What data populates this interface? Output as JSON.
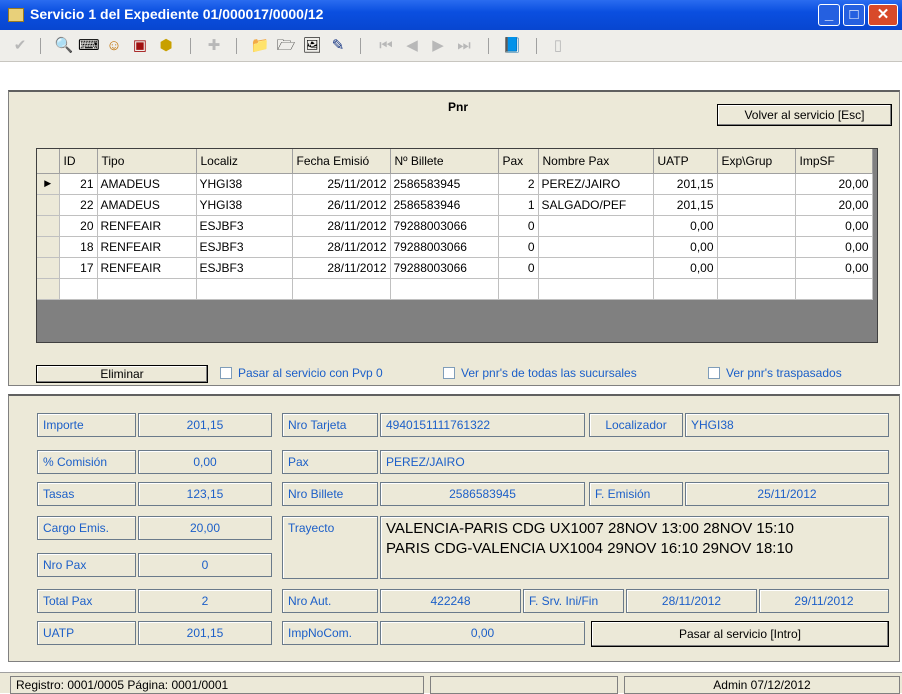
{
  "window": {
    "title": "Servicio 1 del Expediente 01/000017/0000/12",
    "min": "_",
    "max": "□",
    "close": "✕"
  },
  "toolbar": {
    "icons": [
      "check-icon",
      "search-icon",
      "keyboard-icon",
      "smiley-icon",
      "report-icon",
      "cube-icon",
      "plus-icon",
      "folder-new-icon",
      "open-icon",
      "image-icon",
      "edit-icon",
      "first-icon",
      "prev-icon",
      "next-icon",
      "last-icon",
      "book-icon",
      "exit-icon"
    ],
    "glyphs": {
      "check": "✔",
      "search": "🔍",
      "keyboard": "⌨",
      "smiley": "☺",
      "report": "▣",
      "cube": "⬢",
      "plus": "✚",
      "folder_new": "📁",
      "open": "🗁",
      "image": "🖼",
      "edit": "✎",
      "first": "⏮",
      "prev": "◀",
      "next": "▶",
      "last": "⏭",
      "book": "📘",
      "exit": "▯"
    }
  },
  "header": {
    "pnr_label": "Pnr",
    "back_button": "Volver al servicio [Esc]"
  },
  "grid": {
    "columns": [
      "ID",
      "Tipo",
      "Localiz",
      "Fecha Emisió",
      "Nº Billete",
      "Pax",
      "Nombre Pax",
      "UATP",
      "Exp\\Grup",
      "ImpSF"
    ],
    "rows": [
      {
        "current": true,
        "id": "21",
        "tipo": "AMADEUS",
        "localiz": "YHGI38",
        "fecha": "25/11/2012",
        "billete": "2586583945",
        "pax": "2",
        "nombre": "PEREZ/JAIRO",
        "uatp": "201,15",
        "exp": "",
        "impsf": "20,00"
      },
      {
        "current": false,
        "id": "22",
        "tipo": "AMADEUS",
        "localiz": "YHGI38",
        "fecha": "26/11/2012",
        "billete": "2586583946",
        "pax": "1",
        "nombre": "SALGADO/PEF",
        "uatp": "201,15",
        "exp": "",
        "impsf": "20,00"
      },
      {
        "current": false,
        "id": "20",
        "tipo": "RENFEAIR",
        "localiz": "ESJBF3",
        "fecha": "28/11/2012",
        "billete": "79288003066",
        "pax": "0",
        "nombre": "",
        "uatp": "0,00",
        "exp": "",
        "impsf": "0,00"
      },
      {
        "current": false,
        "id": "18",
        "tipo": "RENFEAIR",
        "localiz": "ESJBF3",
        "fecha": "28/11/2012",
        "billete": "79288003066",
        "pax": "0",
        "nombre": "",
        "uatp": "0,00",
        "exp": "",
        "impsf": "0,00"
      },
      {
        "current": false,
        "id": "17",
        "tipo": "RENFEAIR",
        "localiz": "ESJBF3",
        "fecha": "28/11/2012",
        "billete": "79288003066",
        "pax": "0",
        "nombre": "",
        "uatp": "0,00",
        "exp": "",
        "impsf": "0,00"
      }
    ],
    "row_indicator": "▶"
  },
  "actions": {
    "delete": "Eliminar",
    "chk_pvp0": "Pasar al servicio con Pvp 0",
    "chk_all": "Ver pnr's de todas las sucursales",
    "chk_transferred": "Ver pnr's traspasados"
  },
  "detail": {
    "importe_label": "Importe",
    "importe": "201,15",
    "comision_label": "% Comisión",
    "comision": "0,00",
    "tasas_label": "Tasas",
    "tasas": "123,15",
    "cargo_label": "Cargo Emis.",
    "cargo": "20,00",
    "nropax_label": "Nro Pax",
    "nropax": "0",
    "totalpax_label": "Total Pax",
    "totalpax": "2",
    "uatp_label": "UATP",
    "uatp": "201,15",
    "tarjeta_label": "Nro Tarjeta",
    "tarjeta": "4940151111761322",
    "localizador_label": "Localizador",
    "localizador": "YHGI38",
    "pax_label": "Pax",
    "pax": "PEREZ/JAIRO",
    "billete_label": "Nro Billete",
    "billete": "2586583945",
    "emision_label": "F. Emisión",
    "emision": "25/11/2012",
    "trayecto_label": "Trayecto",
    "trayecto_1": "VALENCIA-PARIS CDG UX1007  28NOV 13:00 28NOV 15:10",
    "trayecto_2": "PARIS CDG-VALENCIA UX1004  29NOV 16:10 29NOV 18:10",
    "aut_label": "Nro Aut.",
    "aut": "422248",
    "srv_label": "F. Srv. Ini/Fin",
    "srv_ini": "28/11/2012",
    "srv_fin": "29/11/2012",
    "impnocom_label": "ImpNoCom.",
    "impnocom": "0,00",
    "pasar_button": "Pasar al servicio [Intro]"
  },
  "status": {
    "registro": "Registro: 0001/0005  Página: 0001/0001",
    "middle": "",
    "user": "Admin 07/12/2012"
  }
}
